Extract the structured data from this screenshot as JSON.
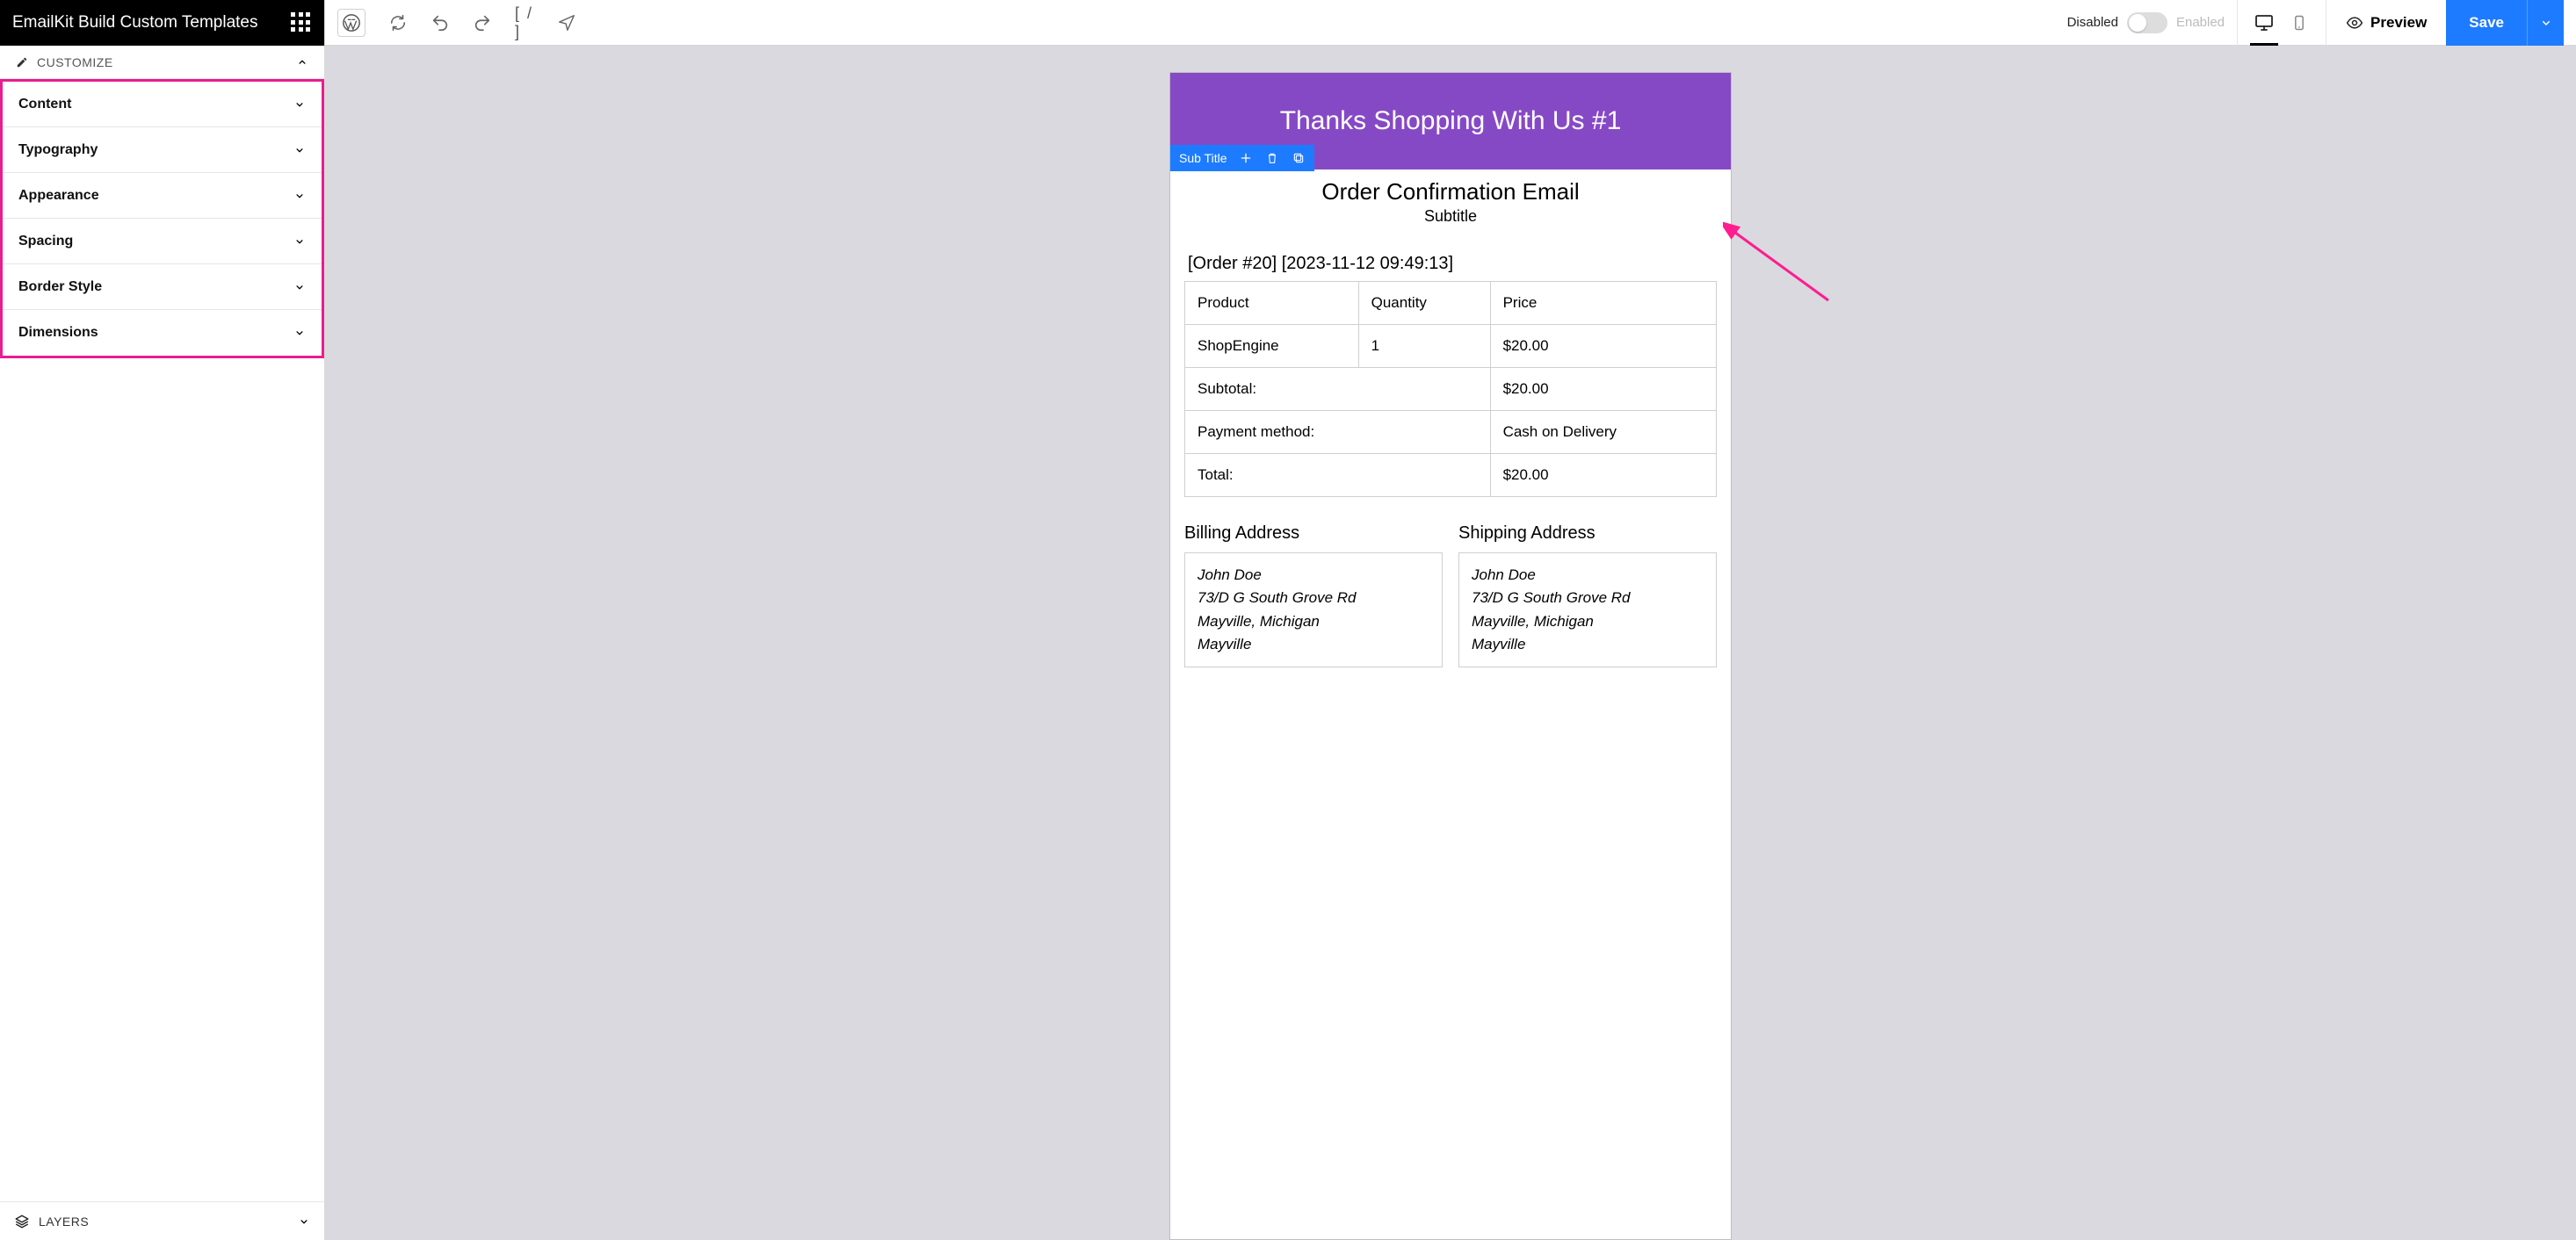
{
  "sidebar": {
    "app_title": "EmailKit Build Custom Templates",
    "customize_label": "CUSTOMIZE",
    "panels": [
      {
        "label": "Content"
      },
      {
        "label": "Typography"
      },
      {
        "label": "Appearance"
      },
      {
        "label": "Spacing"
      },
      {
        "label": "Border Style"
      },
      {
        "label": "Dimensions"
      }
    ],
    "footer_label": "LAYERS"
  },
  "topbar": {
    "shortcode": "[ / ]",
    "disabled_label": "Disabled",
    "enabled_label": "Enabled",
    "preview_label": "Preview",
    "save_label": "Save"
  },
  "selection": {
    "label": "Sub Title"
  },
  "email": {
    "header_text": "Thanks Shopping With Us #1",
    "title": "Order Confirmation Email",
    "subtitle": "Subtitle",
    "order_line": "[Order #20] [2023-11-12 09:49:13]",
    "table": {
      "headers": {
        "product": "Product",
        "qty": "Quantity",
        "price": "Price"
      },
      "rows": [
        {
          "product": "ShopEngine",
          "qty": "1",
          "price": "$20.00"
        }
      ],
      "subtotal_label": "Subtotal:",
      "subtotal_value": "$20.00",
      "payment_label": "Payment method:",
      "payment_value": "Cash on Delivery",
      "total_label": "Total:",
      "total_value": "$20.00"
    },
    "billing": {
      "title": "Billing Address",
      "lines": [
        "John Doe",
        "73/D G South Grove Rd",
        "Mayville, Michigan",
        "Mayville"
      ]
    },
    "shipping": {
      "title": "Shipping Address",
      "lines": [
        "John Doe",
        "73/D G South Grove Rd",
        "Mayville, Michigan",
        "Mayville"
      ]
    }
  }
}
